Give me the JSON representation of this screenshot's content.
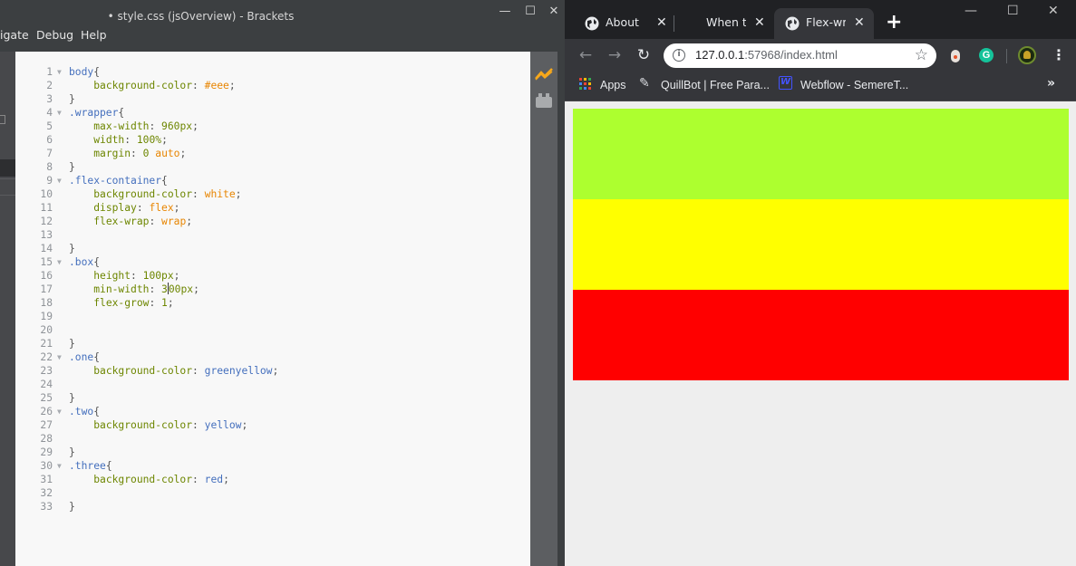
{
  "brackets": {
    "window_title": "• style.css (jsOverview) - Brackets",
    "menu": [
      "igate",
      "Debug",
      "Help"
    ],
    "code_lines": [
      {
        "n": "1",
        "fold": true,
        "html": "<span class=\"sel\">body</span>{"
      },
      {
        "n": "2",
        "fold": false,
        "html": "    <span class=\"prop\">background-color</span>: <span class=\"val\">#eee</span>;"
      },
      {
        "n": "3",
        "fold": false,
        "html": "}"
      },
      {
        "n": "4",
        "fold": true,
        "html": "<span class=\"sel\">.wrapper</span>{"
      },
      {
        "n": "5",
        "fold": false,
        "html": "    <span class=\"prop\">max-width</span>: <span class=\"prop\">960px</span>;"
      },
      {
        "n": "6",
        "fold": false,
        "html": "    <span class=\"prop\">width</span>: <span class=\"prop\">100%</span>;"
      },
      {
        "n": "7",
        "fold": false,
        "html": "    <span class=\"prop\">margin</span>: <span class=\"prop\">0</span> <span class=\"val\">auto</span>;"
      },
      {
        "n": "8",
        "fold": false,
        "html": "}"
      },
      {
        "n": "9",
        "fold": true,
        "html": "<span class=\"sel\">.flex-container</span>{"
      },
      {
        "n": "10",
        "fold": false,
        "html": "    <span class=\"prop\">background-color</span>: <span class=\"val\">white</span>;"
      },
      {
        "n": "11",
        "fold": false,
        "html": "    <span class=\"prop\">display</span>: <span class=\"val\">flex</span>;"
      },
      {
        "n": "12",
        "fold": false,
        "html": "    <span class=\"prop\">flex-wrap</span>: <span class=\"val\">wrap</span>;"
      },
      {
        "n": "13",
        "fold": false,
        "html": ""
      },
      {
        "n": "14",
        "fold": false,
        "html": "}"
      },
      {
        "n": "15",
        "fold": true,
        "html": "<span class=\"sel\">.box</span>{"
      },
      {
        "n": "16",
        "fold": false,
        "html": "    <span class=\"prop\">height</span>: <span class=\"prop\">100px</span>;"
      },
      {
        "n": "17",
        "fold": false,
        "html": "    <span class=\"prop\">min-width</span>: <span class=\"prop\">3<span class=\"cursor\"></span>00px</span>;"
      },
      {
        "n": "18",
        "fold": false,
        "html": "    <span class=\"prop\">flex-grow</span>: <span class=\"prop\">1</span>;"
      },
      {
        "n": "19",
        "fold": false,
        "html": ""
      },
      {
        "n": "20",
        "fold": false,
        "html": ""
      },
      {
        "n": "21",
        "fold": false,
        "html": "}"
      },
      {
        "n": "22",
        "fold": true,
        "html": "<span class=\"sel\">.one</span>{"
      },
      {
        "n": "23",
        "fold": false,
        "html": "    <span class=\"prop\">background-color</span>: <span class=\"kw\">greenyellow</span>;"
      },
      {
        "n": "24",
        "fold": false,
        "html": ""
      },
      {
        "n": "25",
        "fold": false,
        "html": "}"
      },
      {
        "n": "26",
        "fold": true,
        "html": "<span class=\"sel\">.two</span>{"
      },
      {
        "n": "27",
        "fold": false,
        "html": "    <span class=\"prop\">background-color</span>: <span class=\"kw\">yellow</span>;"
      },
      {
        "n": "28",
        "fold": false,
        "html": ""
      },
      {
        "n": "29",
        "fold": false,
        "html": "}"
      },
      {
        "n": "30",
        "fold": true,
        "html": "<span class=\"sel\">.three</span>{"
      },
      {
        "n": "31",
        "fold": false,
        "html": "    <span class=\"prop\">background-color</span>: <span class=\"kw\">red</span>;"
      },
      {
        "n": "32",
        "fold": false,
        "html": ""
      },
      {
        "n": "33",
        "fold": false,
        "html": "}"
      }
    ]
  },
  "chrome": {
    "tabs": [
      {
        "title": "About",
        "active": false
      },
      {
        "title": "When to",
        "active": false
      },
      {
        "title": "Flex-wra",
        "active": true
      }
    ],
    "url_host": "127.0.0.1",
    "url_rest": ":57968/index.html",
    "bookmarks": {
      "apps": "Apps",
      "quillbot": "QuillBot | Free Para...",
      "webflow": "Webflow - SemereT..."
    },
    "page_boxes": [
      {
        "class": "one",
        "color": "#adff2f"
      },
      {
        "class": "two",
        "color": "#ffff00"
      },
      {
        "class": "three",
        "color": "#ff0000"
      }
    ]
  }
}
